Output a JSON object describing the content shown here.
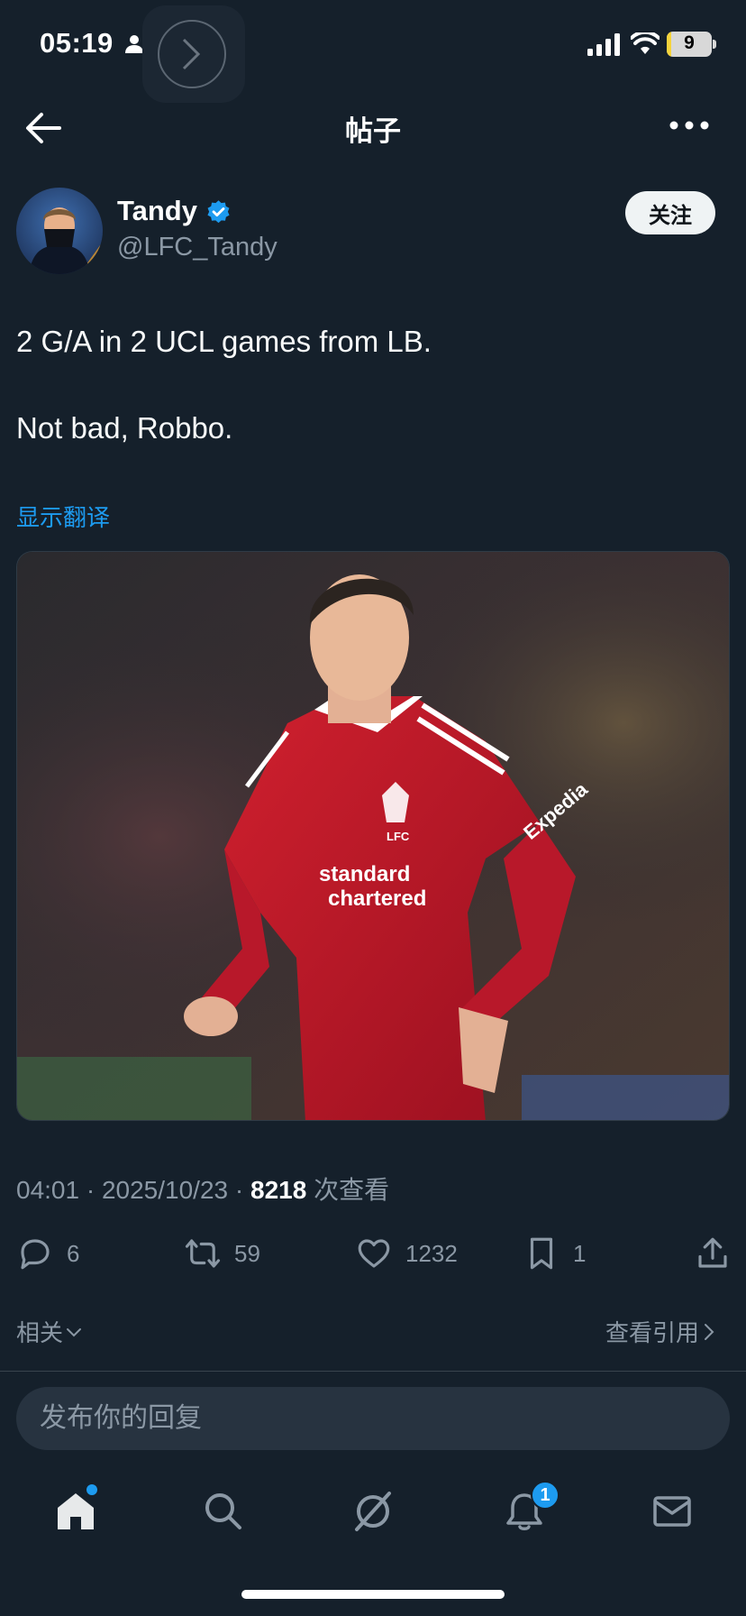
{
  "status_bar": {
    "time": "05:19",
    "battery": "9",
    "battery_level_percent": 9
  },
  "header": {
    "title": "帖子"
  },
  "author": {
    "name": "Tandy",
    "handle": "@LFC_Tandy",
    "follow_label": "关注",
    "verified": true
  },
  "post": {
    "lines": [
      "2 G/A in 2 UCL games from LB.",
      "Not bad, Robbo."
    ],
    "translate_label": "显示翻译",
    "image_caption_words": [
      "standard",
      "chartered",
      "LFC",
      "Expedia"
    ]
  },
  "meta": {
    "time": "04:01",
    "separator": " · ",
    "date": "2025/10/23",
    "views": "8218",
    "views_label": " 次查看"
  },
  "actions": {
    "replies": "6",
    "reposts": "59",
    "likes": "1232",
    "bookmarks": "1"
  },
  "related": {
    "related_label": "相关",
    "view_quotes_label": "查看引用"
  },
  "reply": {
    "placeholder": "发布你的回复"
  },
  "tabbar": {
    "notifications_badge": "1"
  },
  "colors": {
    "background": "#15202b",
    "accent": "#1d9bf0",
    "muted": "#8b98a5",
    "liverpool_red": "#c8102e"
  }
}
